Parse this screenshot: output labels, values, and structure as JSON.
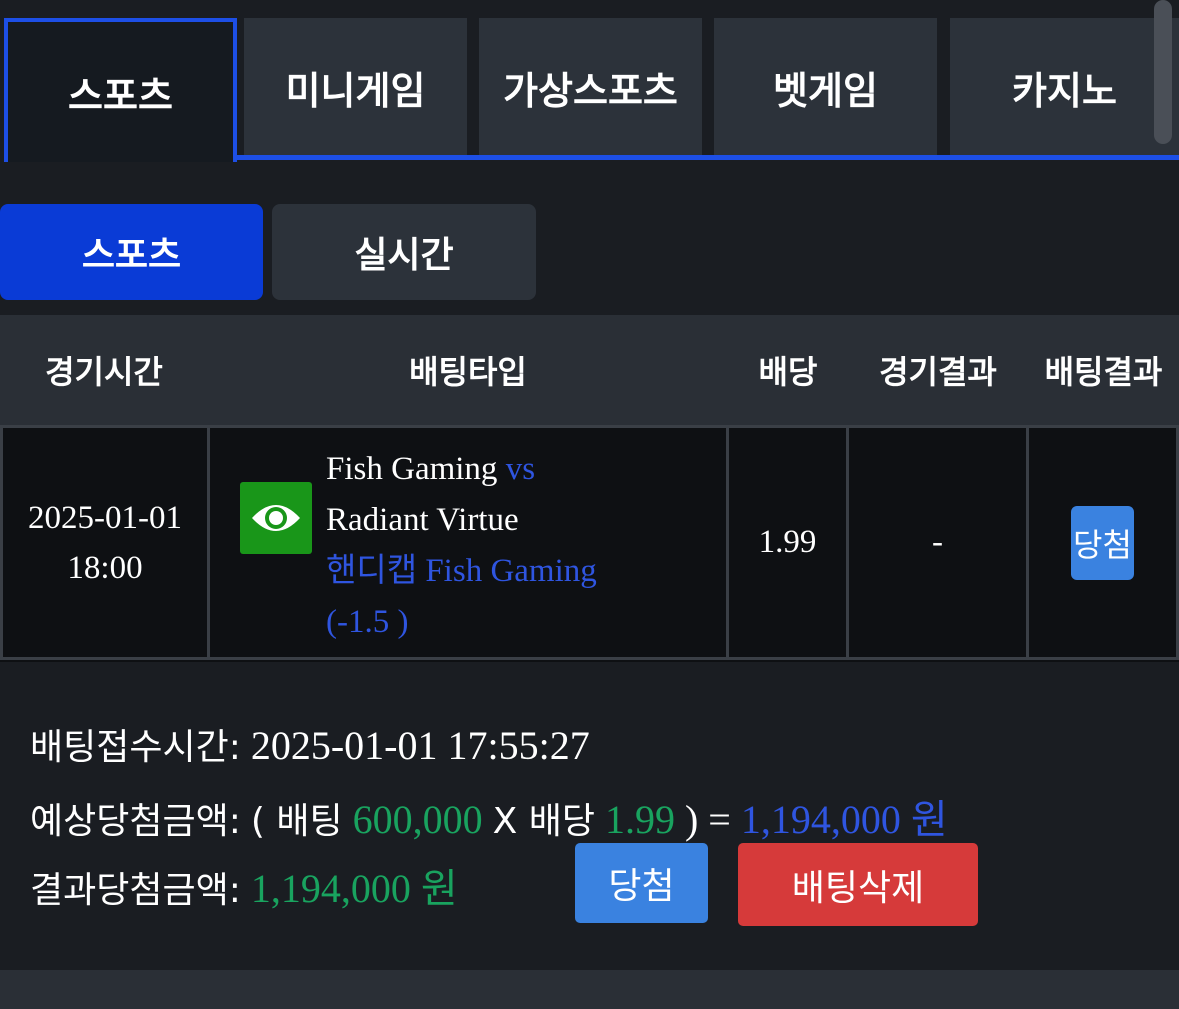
{
  "top_tabs": [
    {
      "label": "스포츠",
      "active": true
    },
    {
      "label": "미니게임",
      "active": false
    },
    {
      "label": "가상스포츠",
      "active": false
    },
    {
      "label": "벳게임",
      "active": false
    },
    {
      "label": "카지노",
      "active": false
    }
  ],
  "sub_tabs": [
    {
      "label": "스포츠",
      "active": true
    },
    {
      "label": "실시간",
      "active": false
    }
  ],
  "table": {
    "headers": [
      "경기시간",
      "배팅타입",
      "배당",
      "경기결과",
      "배팅결과"
    ],
    "row": {
      "date": "2025-01-01",
      "time": "18:00",
      "team_home": "Fish Gaming",
      "vs": "vs",
      "team_away": "Radiant Virtue",
      "bet_type": "핸디캡 Fish Gaming",
      "handicap": "(-1.5 )",
      "odds": "1.99",
      "match_result": "-",
      "bet_result": "당첨",
      "icon": "eye-icon"
    }
  },
  "info": {
    "received_label": "배팅접수시간:",
    "received_value": "2025-01-01 17:55:27",
    "expected_label": "예상당첨금액:",
    "expected_open": "( 배팅",
    "bet_amount": "600,000",
    "times_odds": "X 배당",
    "odds": "1.99",
    "equals": ") =",
    "expected_amount": "1,194,000 원",
    "result_label": "결과당첨금액:",
    "result_amount": "1,194,000 원"
  },
  "buttons": {
    "win": "당첨",
    "delete": "배팅삭제"
  },
  "colors": {
    "accent_blue": "#1d4fe6",
    "active_tab": "#0a3bd6",
    "win_blue": "#3a82e0",
    "delete_red": "#d63a3a",
    "amount_green": "#19a35f",
    "eye_green": "#199619"
  }
}
